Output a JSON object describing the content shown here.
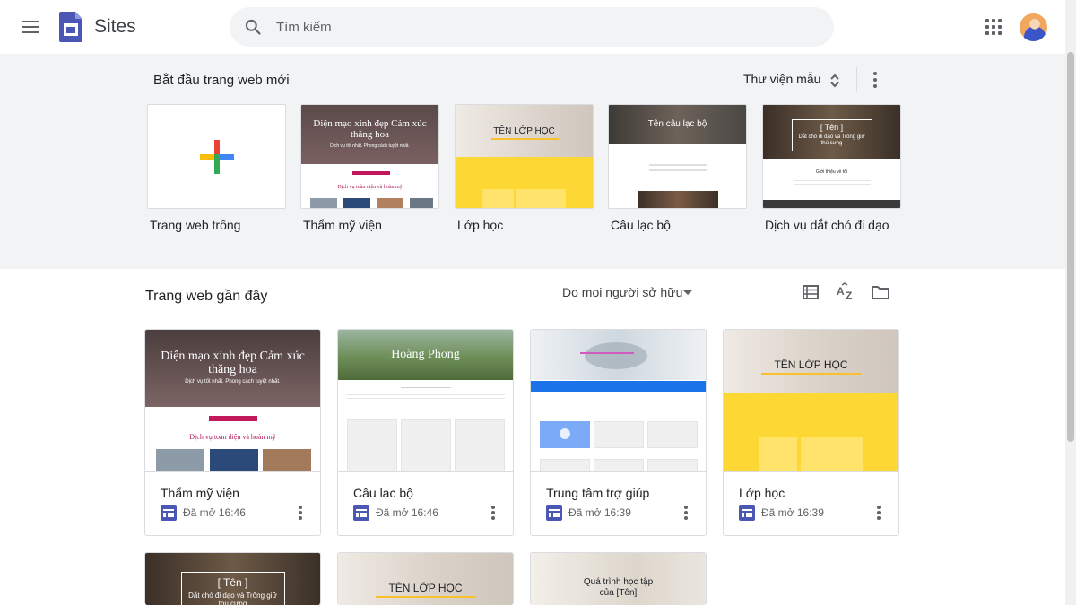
{
  "header": {
    "app_name": "Sites",
    "search_placeholder": "Tìm kiếm",
    "icons": [
      "menu-icon",
      "sites-logo-icon",
      "search-icon",
      "apps-grid-icon",
      "avatar"
    ]
  },
  "templates": {
    "title": "Bắt đầu trang web mới",
    "gallery_label": "Thư viện mẫu",
    "items": [
      {
        "label": "Trang web trống"
      },
      {
        "label": "Thẩm mỹ viện",
        "thumb_title": "Diện mạo xinh đẹp Cảm xúc thăng hoa",
        "thumb_sub": "Dịch vụ tốt nhất. Phong cách tuyệt nhất.",
        "thumb_section": "Dịch vụ toàn diện và hoàn mỹ"
      },
      {
        "label": "Lớp học",
        "thumb_title": "TÊN LỚP HỌC"
      },
      {
        "label": "Câu lạc bộ",
        "thumb_title": "Tên câu lạc bộ"
      },
      {
        "label": "Dịch vụ dắt chó đi dạo",
        "thumb_title": "[ Tên ]",
        "thumb_sub": "Dắt chó đi dạo và Trông giữ thú cưng",
        "thumb_section": "Giới thiệu về tôi"
      }
    ]
  },
  "recent": {
    "title": "Trang web gần đây",
    "owner_filter": "Do mọi người sở hữu",
    "sites": [
      {
        "name": "Thẩm mỹ viện",
        "opened": "Đã mở 16:46",
        "thumb_title": "Diện mạo xinh đẹp Cảm xúc thăng hoa",
        "thumb_sub": "Dịch vụ tốt nhất. Phong cách tuyệt nhất.",
        "thumb_section": "Dịch vụ toàn diện và hoàn mỹ"
      },
      {
        "name": "Câu lạc bộ",
        "opened": "Đã mở 16:46",
        "thumb_title": "Hoàng Phong"
      },
      {
        "name": "Trung tâm trợ giúp",
        "opened": "Đã mở 16:39"
      },
      {
        "name": "Lớp học",
        "opened": "Đã mở 16:39",
        "thumb_title": "TÊN LỚP HỌC"
      }
    ],
    "partial_sites": [
      {
        "thumb_title": "[ Tên ]",
        "thumb_sub": "Dắt chó đi dạo và Trông giữ thú cưng"
      },
      {
        "thumb_title": "TÊN LỚP HỌC"
      },
      {
        "thumb_title": "Quá trình học tập của [Tên]"
      }
    ]
  },
  "colors": {
    "accent_blue": "#4e6ad7",
    "sites_logo": "#4a57b4",
    "class_yellow": "#fdd835",
    "section_bg": "#f1f3f4"
  }
}
